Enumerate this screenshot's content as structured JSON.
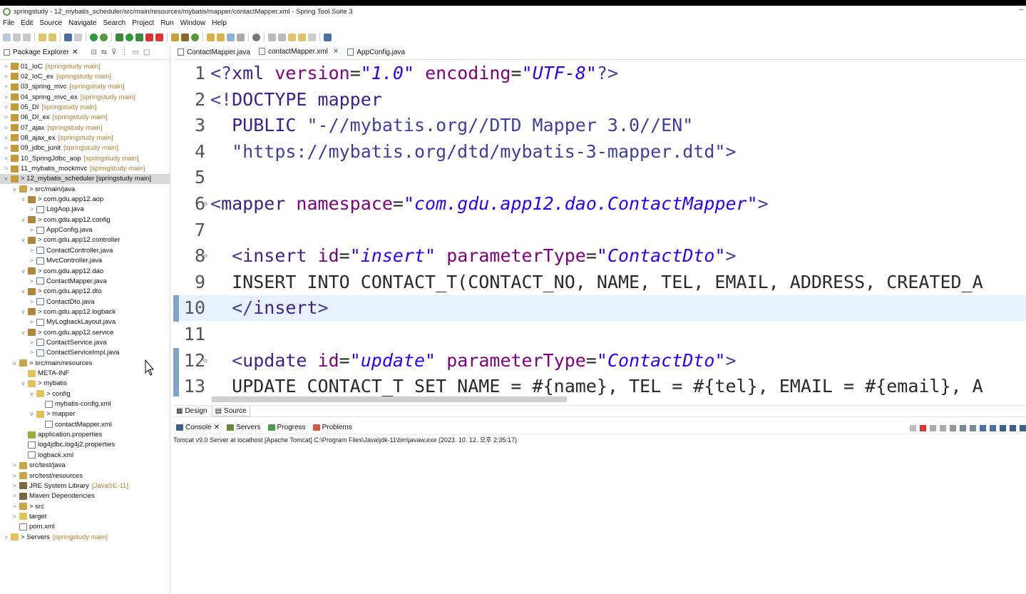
{
  "window": {
    "title": "springstudy - 12_mybatis_scheduler/src/main/resources/mybatis/mapper/contactMapper.xml - Spring Tool Suite 3",
    "minimize": "–"
  },
  "menu": [
    "File",
    "Edit",
    "Source",
    "Navigate",
    "Search",
    "Project",
    "Run",
    "Window",
    "Help"
  ],
  "package_explorer": {
    "tab_label": "Package Explorer",
    "tree": [
      {
        "depth": 0,
        "twisty": ">",
        "icon": "proj",
        "label": "01_IoC",
        "dec": "[springstudy main]"
      },
      {
        "depth": 0,
        "twisty": ">",
        "icon": "proj",
        "label": "02_IoC_ex",
        "dec": "[springstudy main]"
      },
      {
        "depth": 0,
        "twisty": ">",
        "icon": "proj",
        "label": "03_spring_mvc",
        "dec": "[springstudy main]"
      },
      {
        "depth": 0,
        "twisty": ">",
        "icon": "proj",
        "label": "04_spring_mvc_ex",
        "dec": "[springstudy main]"
      },
      {
        "depth": 0,
        "twisty": ">",
        "icon": "proj",
        "label": "05_DI",
        "dec": "[springstudy main]"
      },
      {
        "depth": 0,
        "twisty": ">",
        "icon": "proj",
        "label": "06_DI_ex",
        "dec": "[springstudy main]"
      },
      {
        "depth": 0,
        "twisty": ">",
        "icon": "proj",
        "label": "07_ajax",
        "dec": "[springstudy main]"
      },
      {
        "depth": 0,
        "twisty": ">",
        "icon": "proj",
        "label": "08_ajax_ex",
        "dec": "[springstudy main]"
      },
      {
        "depth": 0,
        "twisty": ">",
        "icon": "proj",
        "label": "09_jdbc_junit",
        "dec": "[springstudy main]"
      },
      {
        "depth": 0,
        "twisty": ">",
        "icon": "proj",
        "label": "10_SpringJdbc_aop",
        "dec": "[springstudy main]"
      },
      {
        "depth": 0,
        "twisty": ">",
        "icon": "proj",
        "label": "11_mybatis_mockmvc",
        "dec": "[springstudy main]"
      },
      {
        "depth": 0,
        "twisty": "v",
        "icon": "proj",
        "label": "> 12_mybatis_scheduler [springstudy main]",
        "dec": "",
        "selected": true
      },
      {
        "depth": 1,
        "twisty": "v",
        "icon": "src",
        "label": "> src/main/java",
        "dec": ""
      },
      {
        "depth": 2,
        "twisty": "v",
        "icon": "pkg",
        "label": "> com.gdu.app12.aop",
        "dec": ""
      },
      {
        "depth": 3,
        "twisty": ">",
        "icon": "java",
        "label": "LogAop.java",
        "dec": ""
      },
      {
        "depth": 2,
        "twisty": "v",
        "icon": "pkg",
        "label": "> com.gdu.app12.config",
        "dec": ""
      },
      {
        "depth": 3,
        "twisty": ">",
        "icon": "java",
        "label": "AppConfig.java",
        "dec": ""
      },
      {
        "depth": 2,
        "twisty": "v",
        "icon": "pkg",
        "label": "> com.gdu.app12.controller",
        "dec": ""
      },
      {
        "depth": 3,
        "twisty": ">",
        "icon": "java",
        "label": "ContactController.java",
        "dec": ""
      },
      {
        "depth": 3,
        "twisty": ">",
        "icon": "java",
        "label": "MvcController.java",
        "dec": ""
      },
      {
        "depth": 2,
        "twisty": "v",
        "icon": "pkg",
        "label": "> com.gdu.app12.dao",
        "dec": ""
      },
      {
        "depth": 3,
        "twisty": ">",
        "icon": "java",
        "label": "ContactMapper.java",
        "dec": ""
      },
      {
        "depth": 2,
        "twisty": "v",
        "icon": "pkg",
        "label": "> com.gdu.app12.dto",
        "dec": ""
      },
      {
        "depth": 3,
        "twisty": ">",
        "icon": "java",
        "label": "ContactDto.java",
        "dec": ""
      },
      {
        "depth": 2,
        "twisty": "v",
        "icon": "pkg",
        "label": "> com.gdu.app12.logback",
        "dec": ""
      },
      {
        "depth": 3,
        "twisty": ">",
        "icon": "java",
        "label": "MyLogbackLayout.java",
        "dec": ""
      },
      {
        "depth": 2,
        "twisty": "v",
        "icon": "pkg",
        "label": "> com.gdu.app12.service",
        "dec": ""
      },
      {
        "depth": 3,
        "twisty": ">",
        "icon": "java",
        "label": "ContactService.java",
        "dec": ""
      },
      {
        "depth": 3,
        "twisty": ">",
        "icon": "java",
        "label": "ContactServiceImpl.java",
        "dec": ""
      },
      {
        "depth": 1,
        "twisty": "v",
        "icon": "src",
        "label": "> src/main/resources",
        "dec": ""
      },
      {
        "depth": 2,
        "twisty": "",
        "icon": "folder",
        "label": "META-INF",
        "dec": ""
      },
      {
        "depth": 2,
        "twisty": "v",
        "icon": "folder",
        "label": "> mybatis",
        "dec": ""
      },
      {
        "depth": 3,
        "twisty": "v",
        "icon": "folder",
        "label": "> config",
        "dec": ""
      },
      {
        "depth": 4,
        "twisty": "",
        "icon": "xml",
        "label": "mybatis-config.xml",
        "dec": ""
      },
      {
        "depth": 3,
        "twisty": "v",
        "icon": "folder",
        "label": "> mapper",
        "dec": ""
      },
      {
        "depth": 4,
        "twisty": "",
        "icon": "xml",
        "label": "contactMapper.xml",
        "dec": ""
      },
      {
        "depth": 2,
        "twisty": "",
        "icon": "prop",
        "label": "application.properties",
        "dec": ""
      },
      {
        "depth": 2,
        "twisty": "",
        "icon": "java",
        "label": "log4jdbc.log4j2.properties",
        "dec": ""
      },
      {
        "depth": 2,
        "twisty": "",
        "icon": "xml",
        "label": "logback.xml",
        "dec": ""
      },
      {
        "depth": 1,
        "twisty": ">",
        "icon": "src",
        "label": "src/test/java",
        "dec": ""
      },
      {
        "depth": 1,
        "twisty": ">",
        "icon": "src",
        "label": "src/test/resources",
        "dec": ""
      },
      {
        "depth": 1,
        "twisty": ">",
        "icon": "lib",
        "label": "JRE System Library",
        "dec": "[JavaSE-11]"
      },
      {
        "depth": 1,
        "twisty": ">",
        "icon": "lib",
        "label": "Maven Dependencies",
        "dec": ""
      },
      {
        "depth": 1,
        "twisty": ">",
        "icon": "src",
        "label": "> src",
        "dec": ""
      },
      {
        "depth": 1,
        "twisty": ">",
        "icon": "folder",
        "label": "target",
        "dec": ""
      },
      {
        "depth": 1,
        "twisty": "",
        "icon": "xml",
        "label": "pom.xml",
        "dec": ""
      },
      {
        "depth": 0,
        "twisty": ">",
        "icon": "folder",
        "label": "> Servers",
        "dec": "[springstudy main]"
      }
    ]
  },
  "editor_tabs": [
    {
      "label": "ContactMapper.java",
      "active": false
    },
    {
      "label": "contactMapper.xml",
      "active": true
    },
    {
      "label": "AppConfig.java",
      "active": false
    }
  ],
  "code_lines": [
    {
      "n": "1",
      "parts": [
        [
          "tag",
          "<?"
        ],
        [
          "k",
          "xml "
        ],
        [
          "attr",
          "version"
        ],
        [
          "plain",
          "="
        ],
        [
          "str",
          "\"1.0\""
        ],
        [
          "plain",
          " "
        ],
        [
          "attr",
          "encoding"
        ],
        [
          "plain",
          "="
        ],
        [
          "str",
          "\"UTF-8\""
        ],
        [
          "tag",
          "?>"
        ]
      ]
    },
    {
      "n": "2",
      "parts": [
        [
          "tag",
          "<!"
        ],
        [
          "k",
          "DOCTYPE mapper"
        ]
      ]
    },
    {
      "n": "3",
      "parts": [
        [
          "plain",
          "  "
        ],
        [
          "k",
          "PUBLIC "
        ],
        [
          "tag",
          "\"-//mybatis.org//DTD Mapper 3.0//EN\""
        ]
      ]
    },
    {
      "n": "4",
      "parts": [
        [
          "plain",
          "  "
        ],
        [
          "tag",
          "\"https://mybatis.org/dtd/mybatis-3-mapper.dtd\">"
        ]
      ]
    },
    {
      "n": "5",
      "parts": []
    },
    {
      "n": "6",
      "fold": true,
      "parts": [
        [
          "tag",
          "<"
        ],
        [
          "k",
          "mapper "
        ],
        [
          "attr",
          "namespace"
        ],
        [
          "plain",
          "="
        ],
        [
          "str",
          "\"com.gdu.app12.dao.ContactMapper\""
        ],
        [
          "tag",
          ">"
        ]
      ]
    },
    {
      "n": "7",
      "parts": []
    },
    {
      "n": "8",
      "fold": true,
      "parts": [
        [
          "plain",
          "  "
        ],
        [
          "tag",
          "<"
        ],
        [
          "k",
          "insert "
        ],
        [
          "attr",
          "id"
        ],
        [
          "plain",
          "="
        ],
        [
          "str",
          "\"insert\""
        ],
        [
          "plain",
          " "
        ],
        [
          "attr",
          "parameterType"
        ],
        [
          "plain",
          "="
        ],
        [
          "str",
          "\"ContactDto\""
        ],
        [
          "tag",
          ">"
        ]
      ]
    },
    {
      "n": "9",
      "parts": [
        [
          "plain",
          "  INSERT INTO CONTACT_T(CONTACT_NO, NAME, TEL, EMAIL, ADDRESS, CREATED_A"
        ]
      ]
    },
    {
      "n": "10",
      "current": true,
      "parts": [
        [
          "plain",
          "  "
        ],
        [
          "tag",
          "</"
        ],
        [
          "k",
          "insert"
        ],
        [
          "tag",
          ">"
        ]
      ]
    },
    {
      "n": "11",
      "parts": []
    },
    {
      "n": "12",
      "fold": true,
      "parts": [
        [
          "plain",
          "  "
        ],
        [
          "tag",
          "<"
        ],
        [
          "k",
          "update "
        ],
        [
          "attr",
          "id"
        ],
        [
          "plain",
          "="
        ],
        [
          "str",
          "\"update\""
        ],
        [
          "plain",
          " "
        ],
        [
          "attr",
          "parameterType"
        ],
        [
          "plain",
          "="
        ],
        [
          "str",
          "\"ContactDto\""
        ],
        [
          "tag",
          ">"
        ]
      ]
    },
    {
      "n": "13",
      "parts": [
        [
          "plain",
          "  UPDATE CONTACT_T SET NAME = #{name}, TEL = #{tel}, EMAIL = #{email}, A"
        ]
      ]
    }
  ],
  "design_source_tabs": {
    "design": "Design",
    "source": "Source"
  },
  "console_tabs": {
    "console": "Console",
    "servers": "Servers",
    "progress": "Progress",
    "problems": "Problems"
  },
  "console_line": "Tomcat v9.0 Server at localhost [Apache Tomcat] C:\\Program Files\\Java\\jdk-11\\bin\\javaw.exe  (2023. 10. 12. 오후 2:35:17)",
  "colors": {
    "accent": "#7fa4c9",
    "xml_string": "#2a00ff",
    "xml_attr": "#7f007f",
    "xml_tag": "#3f3f9f"
  }
}
